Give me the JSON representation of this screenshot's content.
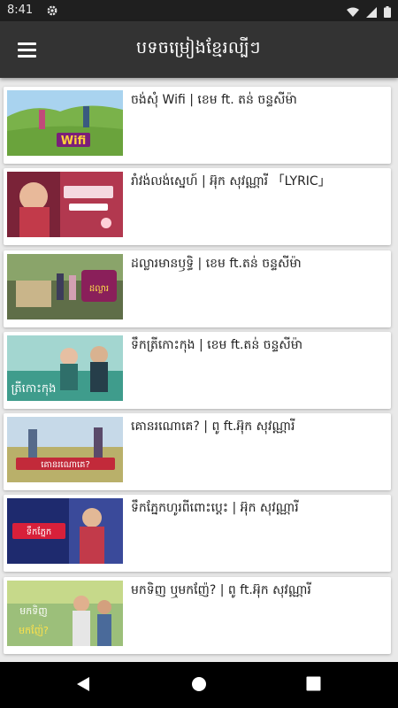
{
  "status_bar": {
    "time": "8:41",
    "icons": [
      "gear-icon",
      "wifi-icon",
      "signal-icon",
      "battery-icon"
    ]
  },
  "app_bar": {
    "title": "បទចម្រៀងខ្មែរល្បីៗ",
    "menu_icon": "hamburger-menu-icon"
  },
  "videos": [
    {
      "title": "ចង់សុំ Wifi | ខេម ft. តន់ ចន្ទសីម៉ា",
      "thumb_text": "Wifi"
    },
    {
      "title": "រាំវង់លង់ស្នេហ៍ | អ៊ុក សុវណ្ណារី 「LYRIC」",
      "thumb_text": ""
    },
    {
      "title": "ដល្លារមានឫទ្ធិ | ខេម ft.តន់ ចន្ទសីម៉ា",
      "thumb_text": ""
    },
    {
      "title": "ទឹកត្រីកោះកុង | ខេម ft.តន់ ចន្ទសីម៉ា",
      "thumb_text": ""
    },
    {
      "title": "គោនរណោគេ? | ពូ ft.អ៊ុក សុវណ្ណារី",
      "thumb_text": ""
    },
    {
      "title": "ទឹកភ្នែកហូរពីពោះប្ដេះ | អ៊ុក សុវណ្ណារី",
      "thumb_text": ""
    },
    {
      "title": "មកទិញ ឬមកញ៉ែ? | ពូ ft.អ៊ុក សុវណ្ណារី",
      "thumb_text": ""
    }
  ],
  "nav_bar": {
    "icons": [
      "back-triangle-icon",
      "home-circle-icon",
      "recents-square-icon"
    ]
  },
  "colors": {
    "app_bar": "#333333",
    "status_bar": "#1f1f1f",
    "background": "#e9e9e9",
    "card": "#ffffff",
    "nav_bar": "#000000"
  }
}
